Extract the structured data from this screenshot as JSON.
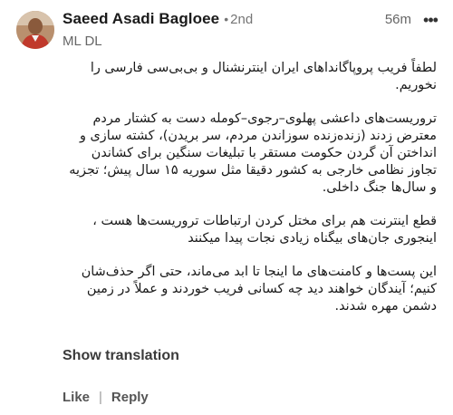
{
  "author": {
    "name": "Saeed Asadi Bagloee",
    "degree": "2nd",
    "headline": "ML DL"
  },
  "timestamp": "56m",
  "body": {
    "paragraphs": [
      "لطفاً فریب پروپاگانداهای ایران اینترنشنال و بی‌بی‌سی فارسی را نخوریم.",
      "تروریست‌های داعشی پهلوی–رجوی–کومله دست به کشتار مردم معترض زدند (زنده‌زنده سوزاندن مردم، سر بریدن)، کشته سازی و انداختن آن گردن حکومت مستقر با تبلیغات سنگین برای کشاندن تجاوز نظامی خارجی به کشور دقیقا مثل سوریه ۱۵ سال پیش؛ تجزیه و سال‌ها جنگ داخلی.",
      "قطع اینترنت هم برای مختل کردن ارتباطات تروریست‌ها هست ، اینجوری جان‌های بیگناه زیادی نجات پیدا میکنند",
      "این پست‌ها و کامنت‌های ما اینجا تا ابد می‌ماند، حتی اگر حذف‌شان کنیم؛ آیندگان خواهند دید چه کسانی فریب خوردند و عملاً در زمین دشمن مهره شدند."
    ]
  },
  "show_translation": "Show translation",
  "actions": {
    "like": "Like",
    "separator": "|",
    "reply": "Reply"
  },
  "icons": {
    "more": "more-horizontal-icon"
  },
  "colors": {
    "text": "#1a1a1a",
    "muted": "#666666",
    "background": "#ffffff"
  }
}
